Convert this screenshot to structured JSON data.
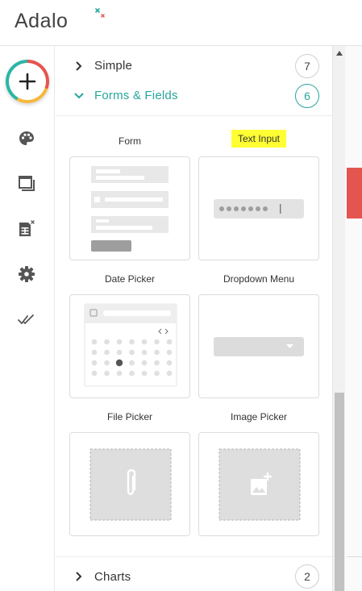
{
  "app": {
    "logo_text": "Adalo"
  },
  "sidebar": {
    "add_button": "add-component",
    "icons": [
      "palette-icon",
      "screens-icon",
      "database-icon",
      "settings-icon",
      "publish-icon"
    ]
  },
  "panel": {
    "sections": {
      "simple": {
        "label": "Simple",
        "count": "7"
      },
      "forms": {
        "label": "Forms & Fields",
        "count": "6"
      },
      "charts": {
        "label": "Charts",
        "count": "2"
      }
    },
    "components": [
      {
        "label": "Form"
      },
      {
        "label": "Text Input"
      },
      {
        "label": "Date Picker"
      },
      {
        "label": "Dropdown Menu"
      },
      {
        "label": "File Picker"
      },
      {
        "label": "Image Picker"
      }
    ]
  },
  "colors": {
    "teal": "#26a69a",
    "red": "#e5554f",
    "yellow_highlight": "#ffff33",
    "logo_accent_1": "#26a69a",
    "logo_accent_2": "#e5554f"
  }
}
